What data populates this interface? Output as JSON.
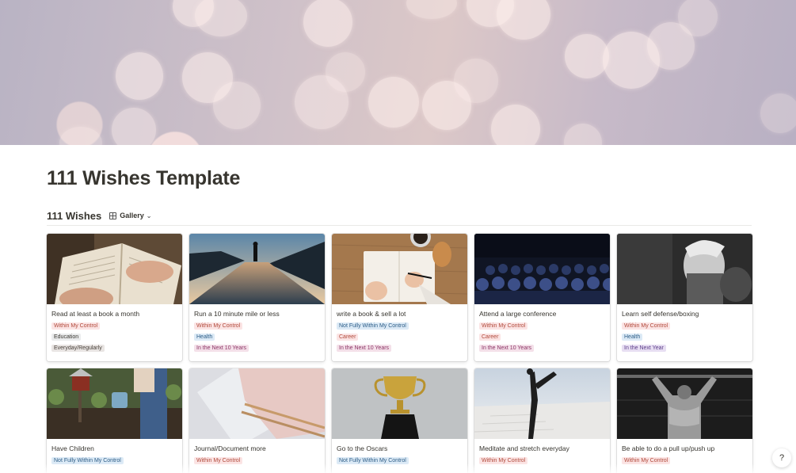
{
  "page": {
    "title": "111 Wishes Template"
  },
  "database": {
    "name": "111 Wishes",
    "view_label": "Gallery",
    "view_icon": "gallery-grid-icon"
  },
  "tag_colors": {
    "control": {
      "bg": "#fbe4e4",
      "fg": "#b14a3b"
    },
    "partial": {
      "bg": "#dceaf6",
      "fg": "#2d5d87"
    },
    "education": {
      "bg": "#ebeced",
      "fg": "#37352f"
    },
    "everyday": {
      "bg": "#e9e5e3",
      "fg": "#48403a"
    },
    "health": {
      "bg": "#dceaf6",
      "fg": "#2d5d87"
    },
    "next10": {
      "bg": "#f4e0e9",
      "fg": "#8c3566"
    },
    "career": {
      "bg": "#fbe4e4",
      "fg": "#b14a3b"
    },
    "nextyear": {
      "bg": "#e7def2",
      "fg": "#5d3f8a"
    }
  },
  "cards": [
    {
      "title": "Read at least a book a month",
      "image_icon": "open-book-image",
      "tags": [
        "Within My Control",
        "Education",
        "Everyday/Regularly"
      ]
    },
    {
      "title": "Run a 10 minute mile or less",
      "image_icon": "runner-road-image",
      "tags": [
        "Within My Control",
        "Health",
        "In the Next 10 Years"
      ]
    },
    {
      "title": "write a book & sell a lot",
      "image_icon": "writing-notebook-image",
      "tags": [
        "Not Fully Within My Control",
        "Career",
        "In the Next 10 Years"
      ]
    },
    {
      "title": "Attend a large conference",
      "image_icon": "conference-audience-image",
      "tags": [
        "Within My Control",
        "Career",
        "In the Next 10 Years"
      ]
    },
    {
      "title": "Learn self defense/boxing",
      "image_icon": "boxer-portrait-image",
      "tags": [
        "Within My Control",
        "Health",
        "In the Next Year"
      ]
    },
    {
      "title": "Have Children",
      "image_icon": "child-garden-image",
      "tags": [
        "Not Fully Within My Control"
      ]
    },
    {
      "title": "Journal/Document more",
      "image_icon": "journal-pencils-image",
      "tags": [
        "Within My Control"
      ]
    },
    {
      "title": "Go to the Oscars",
      "image_icon": "trophy-image",
      "tags": [
        "Not Fully Within My Control"
      ]
    },
    {
      "title": "Meditate and stretch everyday",
      "image_icon": "yoga-stretch-image",
      "tags": [
        "Within My Control"
      ]
    },
    {
      "title": "Be able to do a pull up/push up",
      "image_icon": "pull-up-athlete-image",
      "tags": [
        "Within My Control"
      ]
    }
  ],
  "help": {
    "label": "?"
  }
}
